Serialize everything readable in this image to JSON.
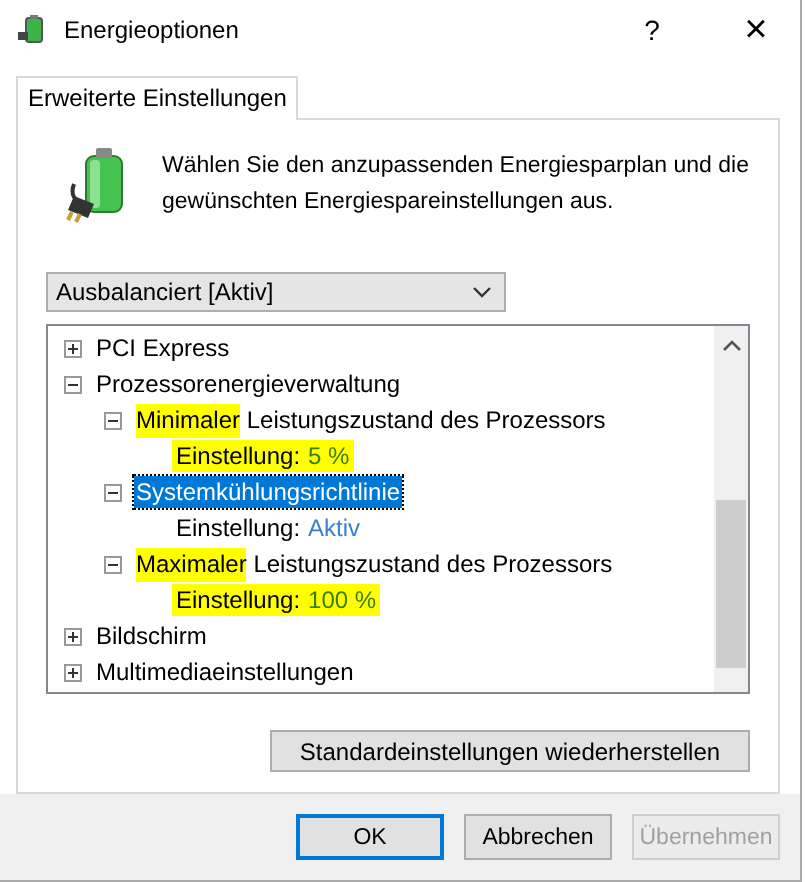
{
  "window": {
    "title": "Energieoptionen",
    "help": "?",
    "close": "×"
  },
  "tabs": [
    {
      "label": "Erweiterte Einstellungen",
      "selected": true
    }
  ],
  "intro": "Wählen Sie den anzupassenden Energiesparplan und die gewünschten Energiespareinstellungen aus.",
  "plan_dropdown": {
    "value": "Ausbalanciert [Aktiv]"
  },
  "tree": [
    {
      "kind": "group",
      "label": "PCI Express",
      "expanded": false,
      "selected": false
    },
    {
      "kind": "group",
      "label": "Prozessorenergieverwaltung",
      "expanded": true,
      "selected": false,
      "children": [
        {
          "kind": "group",
          "marked": "Minimaler",
          "label": "Leistungszustand des Prozessors",
          "expanded": true,
          "selected": false,
          "children": [
            {
              "kind": "setting",
              "label": "Einstellung:",
              "value": "5 %",
              "highlighted": true
            }
          ]
        },
        {
          "kind": "group",
          "label": "Systemkühlungsrichtlinie",
          "expanded": true,
          "selected": true,
          "children": [
            {
              "kind": "setting",
              "label": "Einstellung:",
              "value": "Aktiv",
              "highlighted": false
            }
          ]
        },
        {
          "kind": "group",
          "marked": "Maximaler",
          "label": "Leistungszustand des Prozessors",
          "expanded": true,
          "selected": false,
          "children": [
            {
              "kind": "setting",
              "label": "Einstellung:",
              "value": "100 %",
              "highlighted": true
            }
          ]
        }
      ]
    },
    {
      "kind": "group",
      "label": "Bildschirm",
      "expanded": false,
      "selected": false
    },
    {
      "kind": "group",
      "label": "Multimediaeinstellungen",
      "expanded": false,
      "selected": false
    }
  ],
  "restore_button": "Standardeinstellungen wiederherstellen",
  "buttons": [
    {
      "label": "OK",
      "default": true,
      "disabled": false
    },
    {
      "label": "Abbrechen",
      "default": false,
      "disabled": false
    },
    {
      "label": "Übernehmen",
      "default": false,
      "disabled": true
    }
  ]
}
